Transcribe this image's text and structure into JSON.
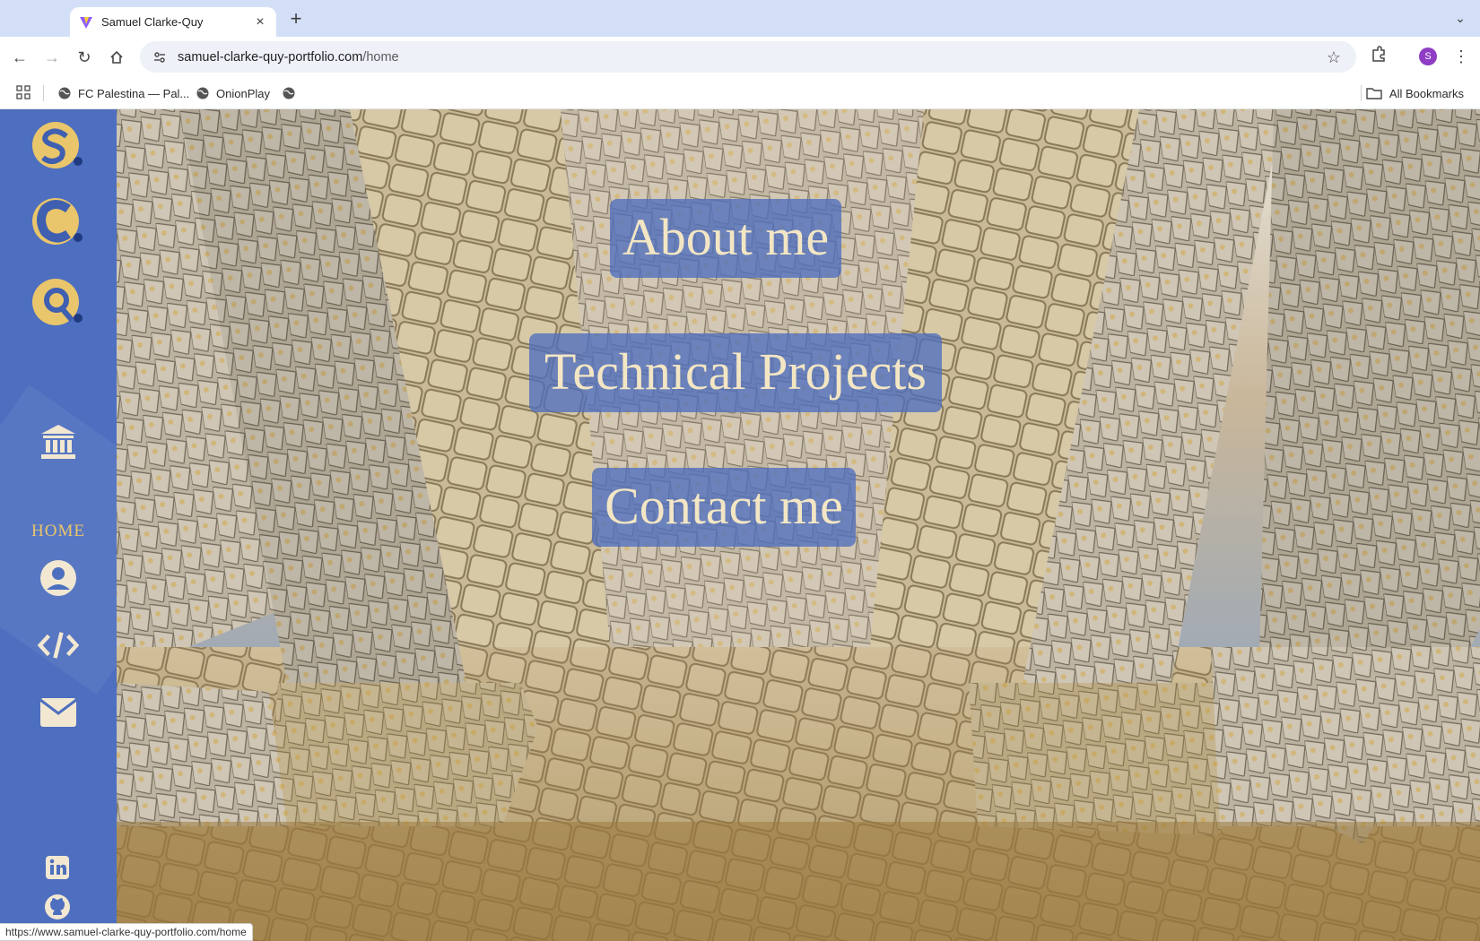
{
  "browser": {
    "tab_title": "Samuel Clarke-Quy",
    "url_host": "samuel-clarke-quy-portfolio.com",
    "url_path": "/home",
    "profile_initial": "S",
    "bookmarks": [
      {
        "label": "FC Palestina — Pal..."
      },
      {
        "label": "OnionPlay"
      },
      {
        "label": ""
      }
    ],
    "all_bookmarks_label": "All Bookmarks",
    "status_url": "https://www.samuel-clarke-quy-portfolio.com/home"
  },
  "sidebar": {
    "logo_letters": [
      "S",
      "C",
      "Q"
    ],
    "home_label": "HOME",
    "accent_color": "#e9c56b",
    "background_color": "#4e6fbf",
    "nav_icons": [
      "museum-icon",
      "user-icon",
      "code-icon",
      "mail-icon"
    ],
    "social_icons": [
      "linkedin-icon",
      "github-icon"
    ]
  },
  "menu": {
    "about_label": "About me",
    "tech_label": "Technical Projects",
    "contact_label": "Contact me"
  }
}
